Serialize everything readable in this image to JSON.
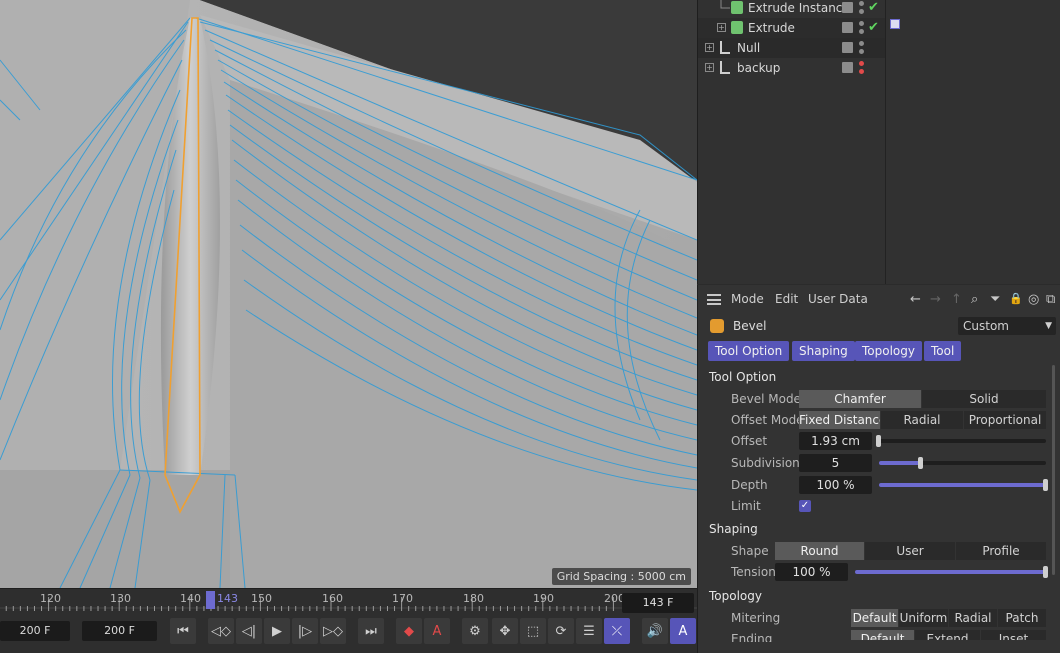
{
  "viewport": {
    "grid_spacing": "Grid Spacing : 5000 cm"
  },
  "timeline": {
    "ticks": [
      "120",
      "130",
      "140",
      "150",
      "160",
      "170",
      "180",
      "190",
      "200"
    ],
    "current_tick": "143",
    "current_frame": "143 F",
    "min_field": "200 F",
    "max_field": "200 F",
    "buttons": {
      "go_start": "⏮",
      "prev_key": "◁◇",
      "step_back": "◁|",
      "play": "▶",
      "step_fwd": "|▷",
      "next_key": "▷◇",
      "go_end": "⏭",
      "record": "◆",
      "auto_key": "A",
      "settings": "⚙",
      "move": "✥",
      "scale": "⬚",
      "rotate": "⟳",
      "params": "☰",
      "pla": "⤫",
      "sound": "🔊",
      "autokey_mode": "A"
    }
  },
  "object_manager": {
    "rows": [
      {
        "label": "Extrude Instance",
        "icon": "extrude-instance-icon",
        "checked": true
      },
      {
        "label": "Extrude",
        "icon": "extrude-icon",
        "checked": true
      },
      {
        "label": "Null",
        "icon": "null-icon",
        "checked": false
      },
      {
        "label": "backup",
        "icon": "null-icon",
        "checked": false
      }
    ]
  },
  "attributes": {
    "menu": {
      "mode": "Mode",
      "edit": "Edit",
      "user_data": "User Data"
    },
    "icons": {
      "back": "←",
      "forward": "→",
      "up": "↑",
      "search": "⌕",
      "filter": "⏷",
      "lock": "🔒",
      "target": "◎",
      "new": "⧉"
    },
    "object_name": "Bevel",
    "preset": "Custom",
    "tabs": [
      "Tool Option",
      "Shaping",
      "Topology",
      "Tool"
    ],
    "tool_option": {
      "title": "Tool Option",
      "bevel_mode_label": "Bevel Mode",
      "bevel_mode_options": [
        "Chamfer",
        "Solid"
      ],
      "offset_mode_label": "Offset Mode",
      "offset_mode_options": [
        "Fixed Distance",
        "Radial",
        "Proportional"
      ],
      "offset_label": "Offset",
      "offset_value": "1.93 cm",
      "offset_fraction": 0.0,
      "subdivision_label": "Subdivision",
      "subdivision_value": "5",
      "subdivision_fraction": 0.25,
      "depth_label": "Depth",
      "depth_value": "100 %",
      "depth_fraction": 1.0,
      "limit_label": "Limit",
      "limit_checked": true
    },
    "shaping": {
      "title": "Shaping",
      "shape_label": "Shape",
      "shape_options": [
        "Round",
        "User",
        "Profile"
      ],
      "tension_label": "Tension",
      "tension_value": "100 %",
      "tension_fraction": 1.0
    },
    "topology": {
      "title": "Topology",
      "mitering_label": "Mitering",
      "mitering_options": [
        "Default",
        "Uniform",
        "Radial",
        "Patch"
      ],
      "ending_label": "Ending",
      "ending_options": [
        "Default",
        "Extend",
        "Inset"
      ]
    }
  },
  "colors": {
    "accent": "#5755b8",
    "wire": "#2f9bd6",
    "selection": "#f0a030",
    "check": "#5fd45f",
    "record": "#e24a4a"
  }
}
